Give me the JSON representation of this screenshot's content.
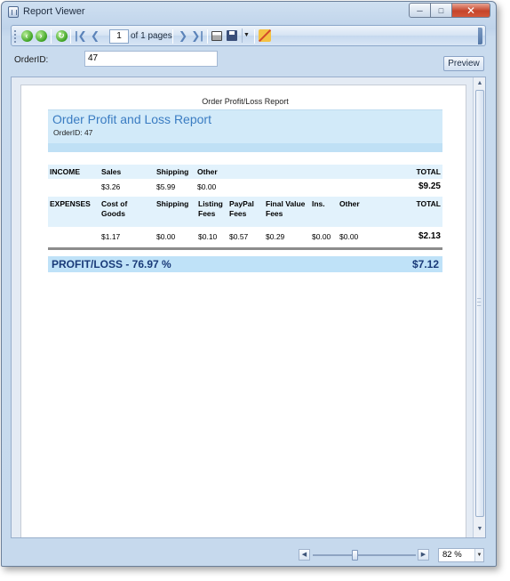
{
  "window": {
    "title": "Report Viewer"
  },
  "toolbar": {
    "page_number": "1",
    "page_of": "of 1 pages",
    "icons": [
      "back-icon",
      "forward-icon",
      "refresh-icon",
      "first-page-icon",
      "previous-page-icon",
      "next-page-icon",
      "last-page-icon",
      "print-icon",
      "save-icon",
      "tools-icon"
    ]
  },
  "parameters": {
    "order_id_label": "OrderID:",
    "order_id_value": "47",
    "preview_label": "Preview"
  },
  "report": {
    "caption": "Order Profit/Loss Report",
    "title": "Order Profit and Loss Report",
    "order_id": "OrderID:  47",
    "income": {
      "label": "INCOME",
      "columns": [
        "Sales",
        "Shipping",
        "Other"
      ],
      "values": [
        "$3.26",
        "$5.99",
        "$0.00"
      ],
      "total_label": "TOTAL",
      "total_value": "$9.25"
    },
    "expenses": {
      "label": "EXPENSES",
      "columns": [
        "Cost of Goods",
        "Shipping",
        "Listing Fees",
        "PayPal Fees",
        "Final Value Fees",
        "Ins.",
        "Other"
      ],
      "values": [
        "$1.17",
        "$0.00",
        "$0.10",
        "$0.57",
        "$0.29",
        "$0.00",
        "$0.00"
      ],
      "total_label": "TOTAL",
      "total_value": "$2.13"
    },
    "profit_loss": {
      "label": "PROFIT/LOSS  -  76.97 %",
      "value": "$7.12"
    }
  },
  "statusbar": {
    "zoom_value": "82 %"
  },
  "colors": {
    "title_blue": "#3a7cc2",
    "profit_blue": "#193a78",
    "header_band": "#d2eaf9"
  }
}
